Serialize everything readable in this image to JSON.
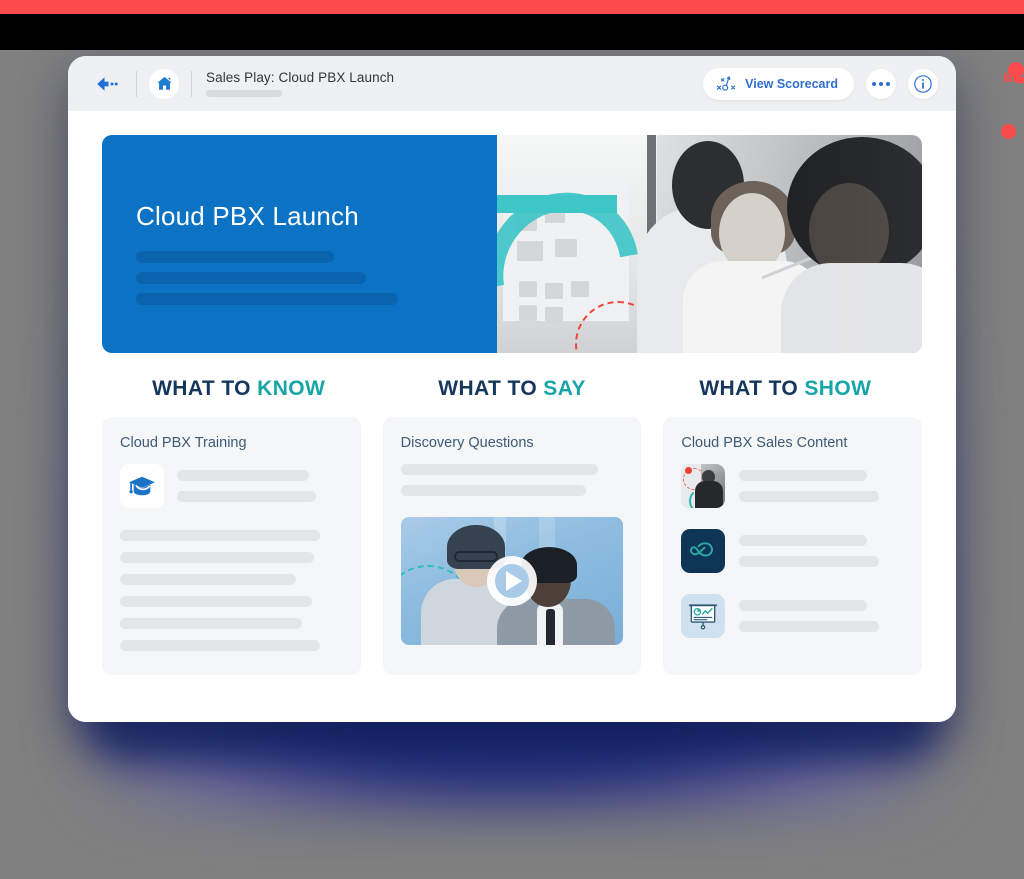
{
  "window": {
    "toolbar": {
      "back_icon": "arrow-left-dotted-icon",
      "home_icon": "home-icon",
      "title": "Sales Play: Cloud PBX Launch",
      "subtitle_placeholder": "",
      "scorecard_button": {
        "label": "View Scorecard",
        "icon": "playbook-strategy-icon"
      },
      "more_button_icon": "ellipsis-icon",
      "info_button_icon": "info-circle-icon"
    },
    "hero": {
      "title": "Cloud PBX Launch",
      "background_color": "#0b72c4",
      "image_alt": "team collaborating at a whiteboard"
    },
    "headings": [
      {
        "prefix": "WHAT TO ",
        "highlight": "KNOW"
      },
      {
        "prefix": "WHAT TO ",
        "highlight": "SAY"
      },
      {
        "prefix": "WHAT TO ",
        "highlight": "SHOW"
      }
    ],
    "cards": [
      {
        "title": "Cloud PBX Training",
        "icon": "graduation-cap-icon"
      },
      {
        "title": "Discovery Questions",
        "video_play_icon": "play-icon"
      },
      {
        "title": "Cloud PBX Sales Content",
        "items": [
          {
            "icon": "photo-thumbnail-icon"
          },
          {
            "icon": "cloud-infinity-logo-icon"
          },
          {
            "icon": "presentation-chart-icon"
          }
        ]
      }
    ]
  },
  "colors": {
    "brand_blue": "#0b72c4",
    "accent_teal": "#18a5a8",
    "heading_navy": "#15375c",
    "link_blue": "#2f6fd0",
    "decor_red": "#fd4b4b"
  }
}
